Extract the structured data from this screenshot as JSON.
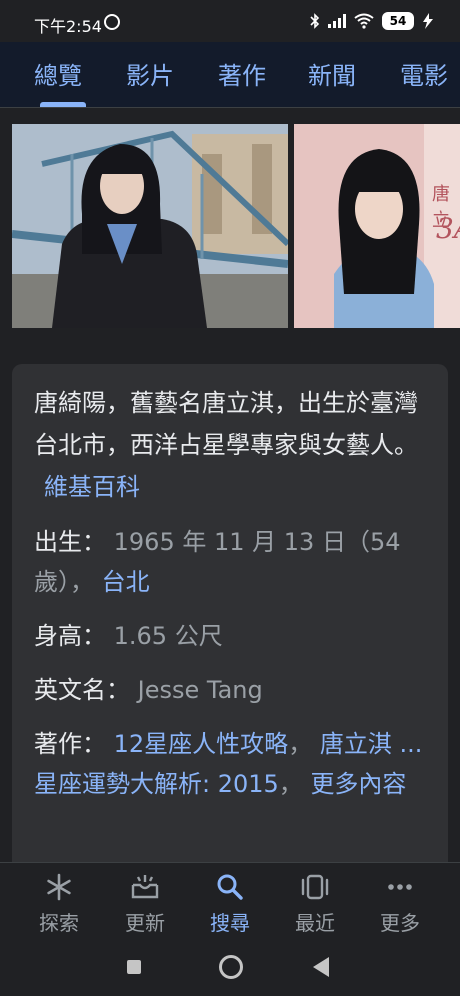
{
  "status": {
    "time": "下午2:54",
    "battery": "54",
    "icons": [
      "alarm-icon",
      "bluetooth-icon",
      "signal-icon",
      "wifi-icon",
      "battery-icon",
      "charging-icon"
    ]
  },
  "tabs": [
    {
      "label": "總覽",
      "active": true
    },
    {
      "label": "影片",
      "active": false
    },
    {
      "label": "著作",
      "active": false
    },
    {
      "label": "新聞",
      "active": false
    },
    {
      "label": "電影",
      "active": false
    }
  ],
  "images": {
    "img2_text": "唐立",
    "img2_text2": "3A"
  },
  "card": {
    "description": "唐綺陽，舊藝名唐立淇，出生於臺灣台北市，西洋占星學專家與女藝人。",
    "source_link": "維基百科",
    "birth": {
      "label": "出生：",
      "value": "1965 年 11 月 13 日（54歲），",
      "place_link": "台北"
    },
    "height": {
      "label": "身高：",
      "value": "1.65 公尺"
    },
    "english_name": {
      "label": "英文名：",
      "value": "Jesse Tang"
    },
    "works": {
      "label": "著作：",
      "link1": "12星座人性攻略",
      "sep1": "，",
      "link2": "唐立淇 ... 星座運勢大解析: 2015",
      "sep2": "，",
      "more_link": "更多內容"
    }
  },
  "bottom_nav": [
    {
      "label": "探索",
      "icon": "asterisk-icon",
      "active": false
    },
    {
      "label": "更新",
      "icon": "inbox-icon",
      "active": false
    },
    {
      "label": "搜尋",
      "icon": "search-icon",
      "active": true
    },
    {
      "label": "最近",
      "icon": "recent-tabs-icon",
      "active": false
    },
    {
      "label": "更多",
      "icon": "more-dots-icon",
      "active": false
    }
  ],
  "colors": {
    "background": "#202124",
    "card": "#303134",
    "accent": "#8ab4f8",
    "tabbar": "#131b2b",
    "muted": "#9aa0a6"
  }
}
